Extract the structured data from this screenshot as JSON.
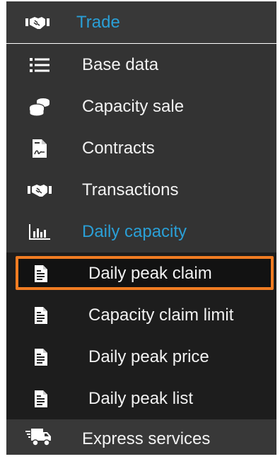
{
  "colors": {
    "accent": "#2a9fd6",
    "highlight_border": "#f07c22",
    "text": "#f2f2f2"
  },
  "menu": {
    "trade": {
      "label": "Trade",
      "icon": "handshake-icon"
    },
    "trade_items": [
      {
        "label": "Base data",
        "icon": "list-icon"
      },
      {
        "label": "Capacity sale",
        "icon": "coins-icon"
      },
      {
        "label": "Contracts",
        "icon": "contract-icon"
      },
      {
        "label": "Transactions",
        "icon": "handshake-icon"
      }
    ],
    "daily_capacity": {
      "label": "Daily capacity",
      "icon": "bar-chart-icon"
    },
    "daily_items": [
      {
        "label": "Daily peak claim",
        "icon": "document-icon",
        "selected": true
      },
      {
        "label": "Capacity claim limit",
        "icon": "document-icon"
      },
      {
        "label": "Daily peak price",
        "icon": "document-icon"
      },
      {
        "label": "Daily peak list",
        "icon": "document-icon"
      }
    ],
    "express": {
      "label": "Express services",
      "icon": "truck-icon"
    }
  }
}
